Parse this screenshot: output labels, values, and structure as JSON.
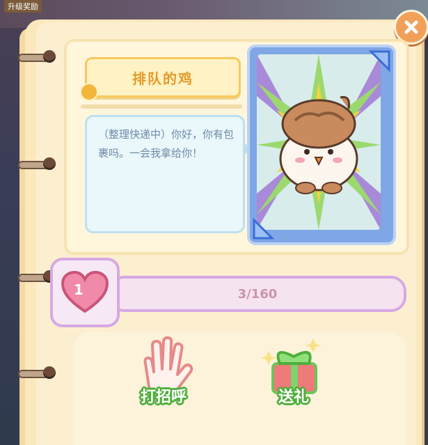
{
  "hud": {
    "top_tag": "升级奖励"
  },
  "character": {
    "name": "排队的鸡",
    "dialog": "（整理快递中）你好，你有包裹吗。一会我拿给你！",
    "card_icon": "chicken-portrait"
  },
  "affection": {
    "level": "1",
    "progress_text": "3/160",
    "current": 3,
    "max": 160
  },
  "actions": [
    {
      "label": "打招呼",
      "icon": "hand-wave-icon"
    },
    {
      "label": "送礼",
      "icon": "gift-icon"
    }
  ],
  "colors": {
    "paper": "#fbe9bd",
    "accent_orange": "#f1a05a",
    "bar_border": "#d6a9e2",
    "action_label_stroke": "#4fae3c"
  }
}
